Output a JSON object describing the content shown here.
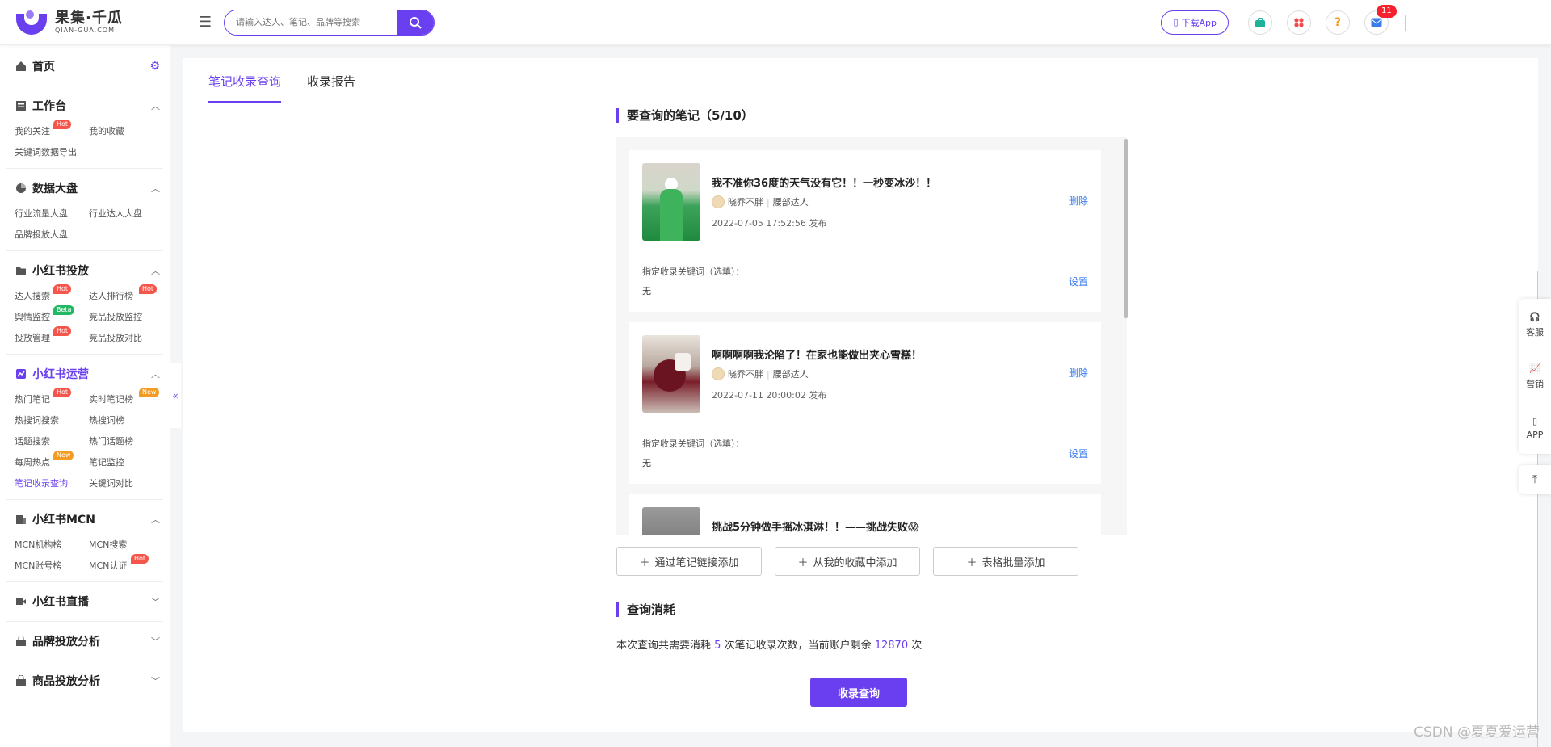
{
  "brand": {
    "name_cn": "果集·千瓜",
    "name_en": "QIAN-GUA.COM",
    "accent": "#6a3fef"
  },
  "search": {
    "placeholder": "请输入达人、笔记、品牌等搜索"
  },
  "header": {
    "download_app": "下载App",
    "notifications": "11"
  },
  "sidebar": {
    "home": "首页",
    "sections": [
      {
        "title": "工作台",
        "items": [
          {
            "label": "我的关注",
            "tag": "Hot"
          },
          {
            "label": "我的收藏"
          },
          {
            "label": "关键词数据导出"
          }
        ]
      },
      {
        "title": "数据大盘",
        "items": [
          {
            "label": "行业流量大盘"
          },
          {
            "label": "行业达人大盘"
          },
          {
            "label": "品牌投放大盘"
          }
        ]
      },
      {
        "title": "小红书投放",
        "items": [
          {
            "label": "达人搜索",
            "tag": "Hot"
          },
          {
            "label": "达人排行榜",
            "tag": "Hot"
          },
          {
            "label": "舆情监控",
            "tag": "Beta"
          },
          {
            "label": "竞品投放监控"
          },
          {
            "label": "投放管理",
            "tag": "Hot"
          },
          {
            "label": "竞品投放对比"
          }
        ]
      },
      {
        "title": "小红书运营",
        "items": [
          {
            "label": "热门笔记",
            "tag": "Hot"
          },
          {
            "label": "实时笔记榜",
            "tag": "New"
          },
          {
            "label": "热搜词搜索"
          },
          {
            "label": "热搜词榜"
          },
          {
            "label": "话题搜索"
          },
          {
            "label": "热门话题榜"
          },
          {
            "label": "每周热点",
            "tag": "New"
          },
          {
            "label": "笔记监控"
          },
          {
            "label": "笔记收录查询"
          },
          {
            "label": "关键词对比"
          }
        ]
      },
      {
        "title": "小红书MCN",
        "items": [
          {
            "label": "MCN机构榜"
          },
          {
            "label": "MCN搜索"
          },
          {
            "label": "MCN账号榜"
          },
          {
            "label": "MCN认证",
            "tag": "Hot"
          }
        ]
      },
      {
        "title": "小红书直播"
      },
      {
        "title": "品牌投放分析"
      },
      {
        "title": "商品投放分析"
      }
    ]
  },
  "tabs": [
    "笔记收录查询",
    "收录报告"
  ],
  "notes_section": {
    "title": "要查询的笔记（5/10）"
  },
  "notes": [
    {
      "title": "我不准你36度的天气没有它！！一秒变冰沙！！",
      "author": "晓乔不胖",
      "level": "腰部达人",
      "date": "2022-07-05 17:52:56 发布",
      "delete": "删除",
      "kw_label": "指定收录关键词（选填）：",
      "kw_value": "无",
      "set": "设置"
    },
    {
      "title": "啊啊啊啊我沦陷了！在家也能做出夹心雪糕！",
      "author": "晓乔不胖",
      "level": "腰部达人",
      "date": "2022-07-11 20:00:02 发布",
      "delete": "删除",
      "kw_label": "指定收录关键词（选填）：",
      "kw_value": "无",
      "set": "设置"
    },
    {
      "title": "挑战5分钟做手摇冰淇淋！！——挑战失败😱"
    }
  ],
  "add_buttons": [
    "通过笔记链接添加",
    "从我的收藏中添加",
    "表格批量添加"
  ],
  "cost": {
    "title": "查询消耗",
    "prefix": "本次查询共需要消耗",
    "count": "5",
    "middle": "次笔记收录次数，当前账户剩余",
    "remaining": "12870",
    "suffix": "次"
  },
  "query_button": "收录查询",
  "float": {
    "service": "客服",
    "marketing": "营销",
    "app": "APP"
  },
  "watermark": "CSDN @夏夏爱运营"
}
